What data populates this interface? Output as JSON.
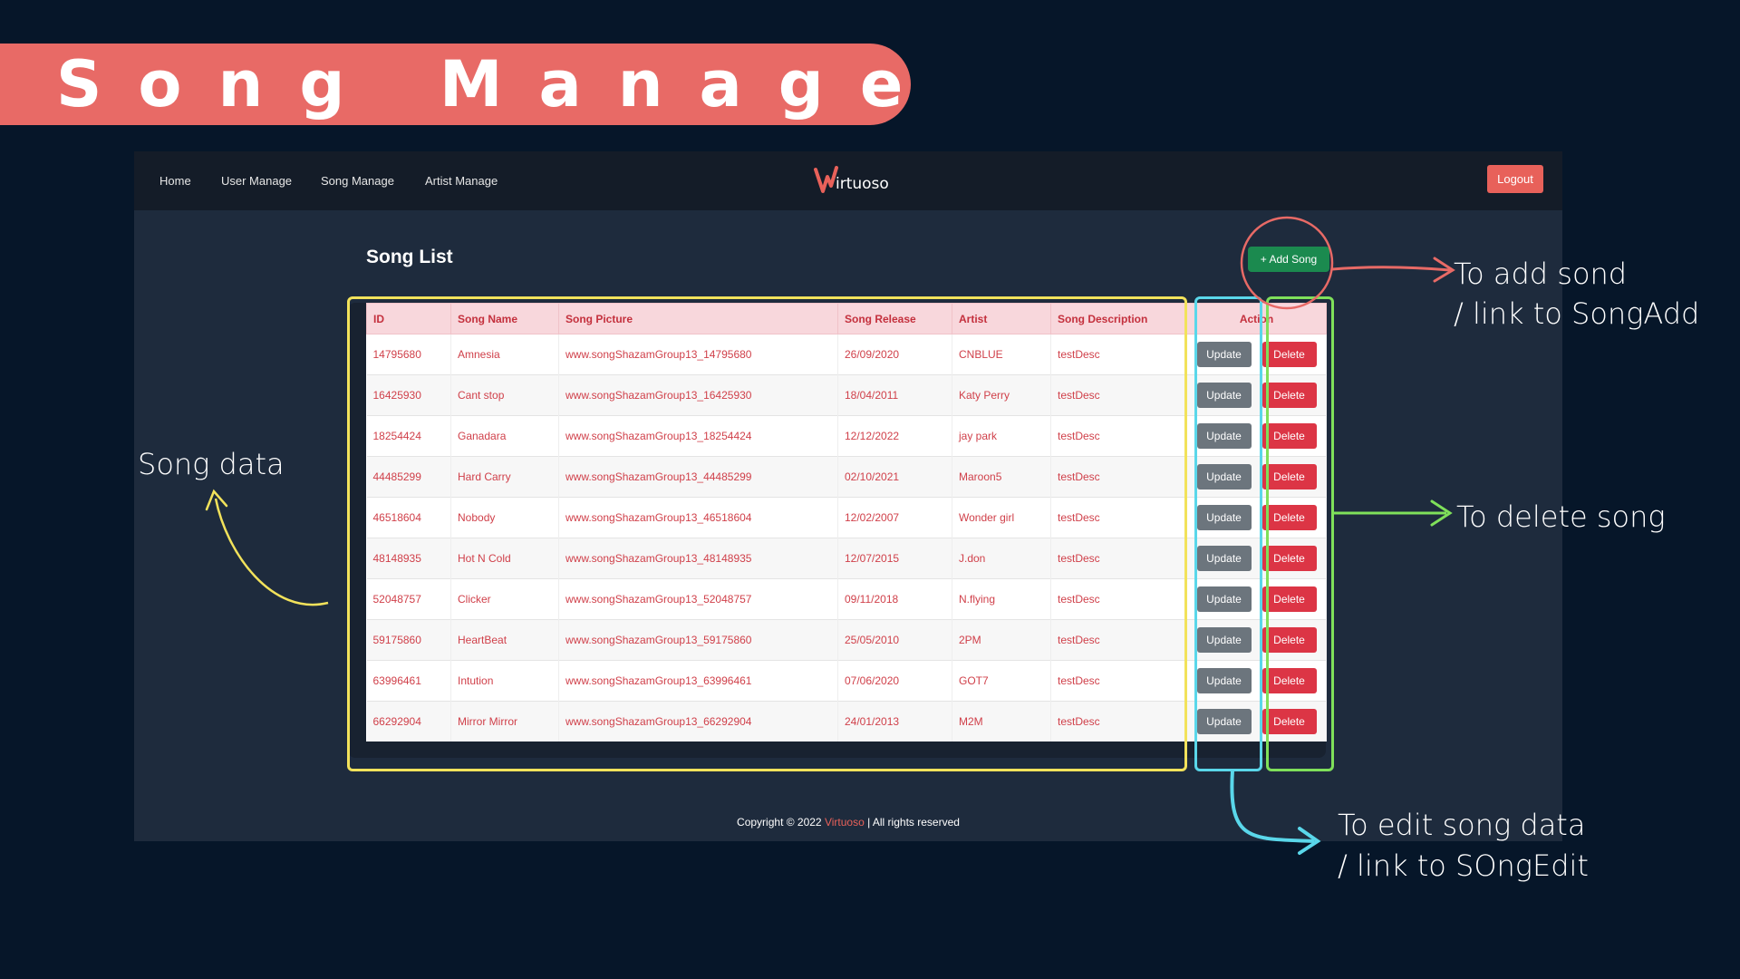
{
  "banner": {
    "title": "Song Manage"
  },
  "nav": {
    "items": [
      {
        "label": "Home"
      },
      {
        "label": "User Manage"
      },
      {
        "label": "Song Manage"
      },
      {
        "label": "Artist Manage"
      }
    ],
    "logo_text": "irtuoso",
    "logout_label": "Logout"
  },
  "main": {
    "title": "Song List",
    "add_label": "+ Add Song"
  },
  "table": {
    "headers": [
      "ID",
      "Song Name",
      "Song Picture",
      "Song Release",
      "Artist",
      "Song Description",
      "Action"
    ],
    "update_label": "Update",
    "delete_label": "Delete",
    "rows": [
      [
        "14795680",
        "Amnesia",
        "www.songShazamGroup13_14795680",
        "26/09/2020",
        "CNBLUE",
        "testDesc"
      ],
      [
        "16425930",
        "Cant stop",
        "www.songShazamGroup13_16425930",
        "18/04/2011",
        "Katy Perry",
        "testDesc"
      ],
      [
        "18254424",
        "Ganadara",
        "www.songShazamGroup13_18254424",
        "12/12/2022",
        "jay park",
        "testDesc"
      ],
      [
        "44485299",
        "Hard Carry",
        "www.songShazamGroup13_44485299",
        "02/10/2021",
        "Maroon5",
        "testDesc"
      ],
      [
        "46518604",
        "Nobody",
        "www.songShazamGroup13_46518604",
        "12/02/2007",
        "Wonder girl",
        "testDesc"
      ],
      [
        "48148935",
        "Hot N Cold",
        "www.songShazamGroup13_48148935",
        "12/07/2015",
        "J.don",
        "testDesc"
      ],
      [
        "52048757",
        "Clicker",
        "www.songShazamGroup13_52048757",
        "09/11/2018",
        "N.flying",
        "testDesc"
      ],
      [
        "59175860",
        "HeartBeat",
        "www.songShazamGroup13_59175860",
        "25/05/2010",
        "2PM",
        "testDesc"
      ],
      [
        "63996461",
        "Intution",
        "www.songShazamGroup13_63996461",
        "07/06/2020",
        "GOT7",
        "testDesc"
      ],
      [
        "66292904",
        "Mirror Mirror",
        "www.songShazamGroup13_66292904",
        "24/01/2013",
        "M2M",
        "testDesc"
      ]
    ]
  },
  "footer": {
    "prefix": "Copyright © 2022 ",
    "brand": "Virtuoso",
    "suffix": " | All rights reserved"
  },
  "annotations": {
    "song_data": "Song data",
    "add_line1": "To add sond",
    "add_line2": "/ link to SongAdd",
    "delete": "To delete song",
    "edit_line1": "To edit song data",
    "edit_line2": "/ link to SOngEdit"
  },
  "colors": {
    "accent": "#e8615a",
    "add_button": "#1b8a4f",
    "update_button": "#6c757d",
    "delete_button": "#dc3545",
    "yellow_annotation": "#f2e25b",
    "blue_annotation": "#5ad7ea",
    "green_annotation": "#7fe05a",
    "red_annotation": "#e86a66"
  }
}
